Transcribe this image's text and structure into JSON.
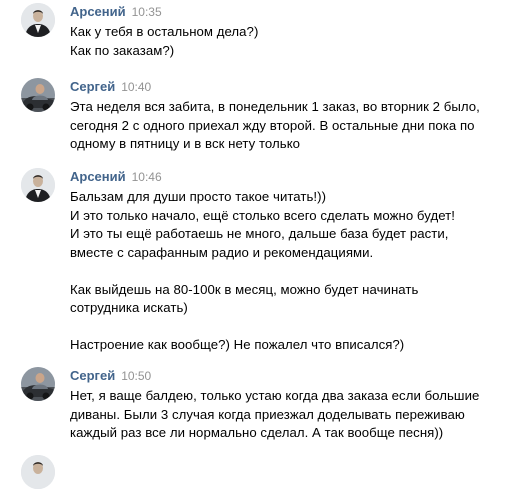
{
  "messages": [
    {
      "author": "Арсений",
      "time": "10:35",
      "avatar_icon": "avatar-man-dark-suit",
      "lines": [
        "Как у тебя в остальном дела?)",
        "Как по заказам?)"
      ]
    },
    {
      "author": "Сергей",
      "time": "10:40",
      "avatar_icon": "avatar-man-car",
      "lines": [
        "Эта неделя вся забита, в понедельник 1 заказ, во вторник 2 было,",
        "сегодня 2 с одного приехал жду второй. В остальные дни пока по",
        "одному в пятницу и в вск нету только"
      ]
    },
    {
      "author": "Арсений",
      "time": "10:46",
      "avatar_icon": "avatar-man-dark-suit",
      "lines": [
        "Бальзам для души просто такое читать!))",
        "И это только начало, ещё столько всего сделать можно будет!",
        "И это ты ещё работаешь не много, дальше база будет расти,",
        "вместе с сарафанным радио и рекомендациями.",
        "",
        "Как выйдешь на 80-100к в месяц, можно будет начинать",
        "сотрудника искать)",
        "",
        "Настроение как вообще?) Не пожалел что вписался?)"
      ]
    },
    {
      "author": "Сергей",
      "time": "10:50",
      "avatar_icon": "avatar-man-car",
      "lines": [
        "Нет, я ваще балдею, только устаю когда два заказа если большие",
        "диваны. Были 3 случая когда приезжал доделывать переживаю",
        "каждый раз все ли нормально сделал. А так вообще песня))"
      ]
    }
  ]
}
